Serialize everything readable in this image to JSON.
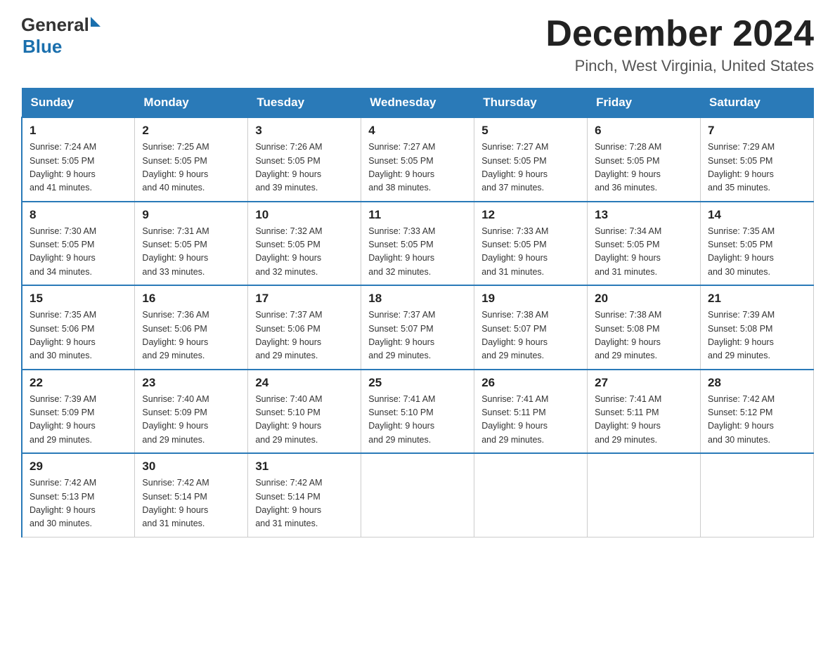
{
  "header": {
    "logo_general": "General",
    "logo_blue": "Blue",
    "month_title": "December 2024",
    "location": "Pinch, West Virginia, United States"
  },
  "days_of_week": [
    "Sunday",
    "Monday",
    "Tuesday",
    "Wednesday",
    "Thursday",
    "Friday",
    "Saturday"
  ],
  "weeks": [
    [
      {
        "day": "1",
        "sunrise": "7:24 AM",
        "sunset": "5:05 PM",
        "daylight": "9 hours and 41 minutes."
      },
      {
        "day": "2",
        "sunrise": "7:25 AM",
        "sunset": "5:05 PM",
        "daylight": "9 hours and 40 minutes."
      },
      {
        "day": "3",
        "sunrise": "7:26 AM",
        "sunset": "5:05 PM",
        "daylight": "9 hours and 39 minutes."
      },
      {
        "day": "4",
        "sunrise": "7:27 AM",
        "sunset": "5:05 PM",
        "daylight": "9 hours and 38 minutes."
      },
      {
        "day": "5",
        "sunrise": "7:27 AM",
        "sunset": "5:05 PM",
        "daylight": "9 hours and 37 minutes."
      },
      {
        "day": "6",
        "sunrise": "7:28 AM",
        "sunset": "5:05 PM",
        "daylight": "9 hours and 36 minutes."
      },
      {
        "day": "7",
        "sunrise": "7:29 AM",
        "sunset": "5:05 PM",
        "daylight": "9 hours and 35 minutes."
      }
    ],
    [
      {
        "day": "8",
        "sunrise": "7:30 AM",
        "sunset": "5:05 PM",
        "daylight": "9 hours and 34 minutes."
      },
      {
        "day": "9",
        "sunrise": "7:31 AM",
        "sunset": "5:05 PM",
        "daylight": "9 hours and 33 minutes."
      },
      {
        "day": "10",
        "sunrise": "7:32 AM",
        "sunset": "5:05 PM",
        "daylight": "9 hours and 32 minutes."
      },
      {
        "day": "11",
        "sunrise": "7:33 AM",
        "sunset": "5:05 PM",
        "daylight": "9 hours and 32 minutes."
      },
      {
        "day": "12",
        "sunrise": "7:33 AM",
        "sunset": "5:05 PM",
        "daylight": "9 hours and 31 minutes."
      },
      {
        "day": "13",
        "sunrise": "7:34 AM",
        "sunset": "5:05 PM",
        "daylight": "9 hours and 31 minutes."
      },
      {
        "day": "14",
        "sunrise": "7:35 AM",
        "sunset": "5:05 PM",
        "daylight": "9 hours and 30 minutes."
      }
    ],
    [
      {
        "day": "15",
        "sunrise": "7:35 AM",
        "sunset": "5:06 PM",
        "daylight": "9 hours and 30 minutes."
      },
      {
        "day": "16",
        "sunrise": "7:36 AM",
        "sunset": "5:06 PM",
        "daylight": "9 hours and 29 minutes."
      },
      {
        "day": "17",
        "sunrise": "7:37 AM",
        "sunset": "5:06 PM",
        "daylight": "9 hours and 29 minutes."
      },
      {
        "day": "18",
        "sunrise": "7:37 AM",
        "sunset": "5:07 PM",
        "daylight": "9 hours and 29 minutes."
      },
      {
        "day": "19",
        "sunrise": "7:38 AM",
        "sunset": "5:07 PM",
        "daylight": "9 hours and 29 minutes."
      },
      {
        "day": "20",
        "sunrise": "7:38 AM",
        "sunset": "5:08 PM",
        "daylight": "9 hours and 29 minutes."
      },
      {
        "day": "21",
        "sunrise": "7:39 AM",
        "sunset": "5:08 PM",
        "daylight": "9 hours and 29 minutes."
      }
    ],
    [
      {
        "day": "22",
        "sunrise": "7:39 AM",
        "sunset": "5:09 PM",
        "daylight": "9 hours and 29 minutes."
      },
      {
        "day": "23",
        "sunrise": "7:40 AM",
        "sunset": "5:09 PM",
        "daylight": "9 hours and 29 minutes."
      },
      {
        "day": "24",
        "sunrise": "7:40 AM",
        "sunset": "5:10 PM",
        "daylight": "9 hours and 29 minutes."
      },
      {
        "day": "25",
        "sunrise": "7:41 AM",
        "sunset": "5:10 PM",
        "daylight": "9 hours and 29 minutes."
      },
      {
        "day": "26",
        "sunrise": "7:41 AM",
        "sunset": "5:11 PM",
        "daylight": "9 hours and 29 minutes."
      },
      {
        "day": "27",
        "sunrise": "7:41 AM",
        "sunset": "5:11 PM",
        "daylight": "9 hours and 29 minutes."
      },
      {
        "day": "28",
        "sunrise": "7:42 AM",
        "sunset": "5:12 PM",
        "daylight": "9 hours and 30 minutes."
      }
    ],
    [
      {
        "day": "29",
        "sunrise": "7:42 AM",
        "sunset": "5:13 PM",
        "daylight": "9 hours and 30 minutes."
      },
      {
        "day": "30",
        "sunrise": "7:42 AM",
        "sunset": "5:14 PM",
        "daylight": "9 hours and 31 minutes."
      },
      {
        "day": "31",
        "sunrise": "7:42 AM",
        "sunset": "5:14 PM",
        "daylight": "9 hours and 31 minutes."
      },
      null,
      null,
      null,
      null
    ]
  ],
  "labels": {
    "sunrise": "Sunrise:",
    "sunset": "Sunset:",
    "daylight": "Daylight:"
  }
}
